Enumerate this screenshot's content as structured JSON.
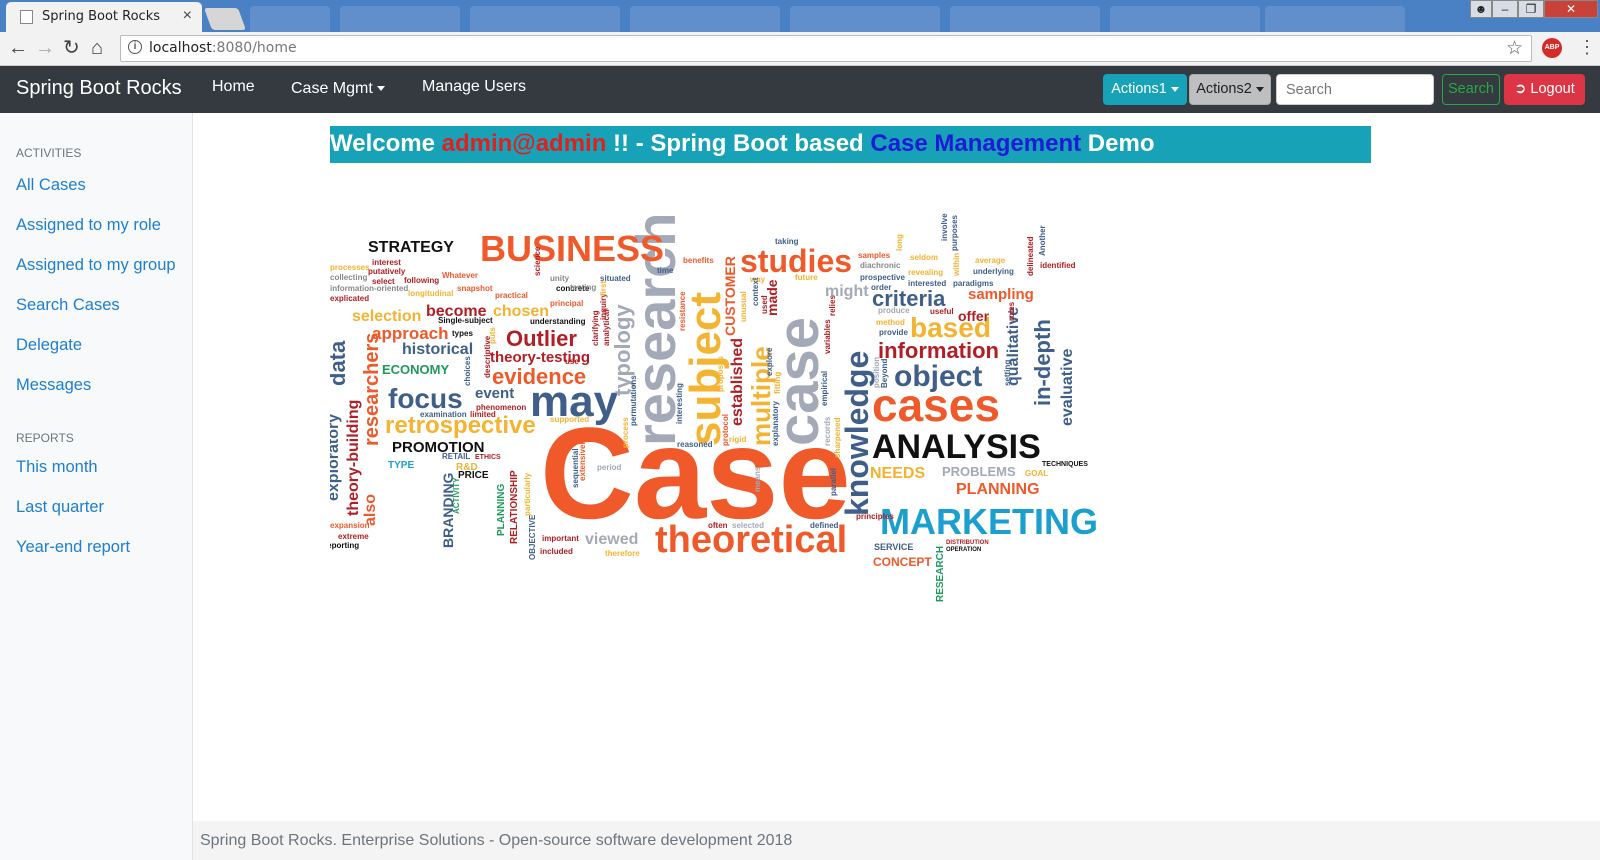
{
  "browser": {
    "tab_title": "Spring Boot Rocks",
    "tab_close": "×",
    "url_host": "localhost",
    "url_path": ":8080/home",
    "adblock_label": "ABP"
  },
  "navbar": {
    "brand": "Spring Boot Rocks",
    "links": {
      "home": "Home",
      "case_mgmt": "Case Mgmt",
      "manage_users": "Manage Users"
    },
    "actions1": "Actions1",
    "actions2": "Actions2",
    "search_placeholder": "Search",
    "search_button": "Search",
    "logout": "Logout"
  },
  "sidebar": {
    "activities_heading": "ACTIVITIES",
    "activities": [
      "All Cases",
      "Assigned to my role",
      "Assigned to my group",
      "Search Cases",
      "Delegate",
      "Messages"
    ],
    "reports_heading": "REPORTS",
    "reports": [
      "This month",
      "Last quarter",
      "Year-end report"
    ]
  },
  "banner": {
    "prefix": "Welcome ",
    "user": "admin@admin",
    "middle": " !! - Spring Boot based ",
    "highlight": "Case Management",
    "suffix": " Demo"
  },
  "wordcloud": {
    "words": [
      "Case",
      "research",
      "case",
      "subject",
      "BUSINESS",
      "MARKETING",
      "theoretical",
      "cases",
      "ANALYSIS",
      "may",
      "knowledge",
      "studies",
      "object",
      "information",
      "retrospective",
      "focus",
      "evidence",
      "Outlier",
      "STRATEGY",
      "criteria",
      "based",
      "PROMOTION",
      "ECONOMY",
      "PLANNING",
      "NEEDS",
      "PROBLEMS",
      "typology",
      "multiple",
      "established",
      "data",
      "researchers",
      "exploratory",
      "theory-building",
      "also",
      "BRANDING",
      "selection",
      "approach",
      "historical",
      "become",
      "chosen",
      "theory-testing",
      "event",
      "viewed",
      "qualitative",
      "in-depth",
      "evaluative",
      "sampling",
      "offer",
      "might",
      "CUSTOMER",
      "CONCEPT",
      "SERVICE",
      "RESEARCH",
      "made",
      "PRICE",
      "RELATIONSHIP",
      "OBJECTIVE",
      "important",
      "included",
      "therefore",
      "often",
      "selected",
      "defined",
      "principles",
      "TECHNIQUES",
      "GOAL",
      "DISTRIBUTION",
      "OPERATION",
      "TYPE",
      "RETAIL",
      "R&D",
      "ETHICS",
      "PLANNING",
      "ACTIVITY",
      "interest",
      "putatively",
      "processes",
      "collecting",
      "information-oriented",
      "explicated",
      "select",
      "following",
      "Whatever",
      "snapshot",
      "longitudinal",
      "practical",
      "science",
      "concrete",
      "principal",
      "situated",
      "testing",
      "unity",
      "taking",
      "benefits",
      "time",
      "future",
      "samples",
      "diachronic",
      "prospective",
      "order",
      "interested",
      "revealing",
      "seldom",
      "average",
      "underlying",
      "paradigms",
      "identified",
      "Another",
      "delineated",
      "Single-subject",
      "types",
      "understanding",
      "examination",
      "phenomenon",
      "limited",
      "supported",
      "period",
      "sequential",
      "extensively",
      "means",
      "explore",
      "fitting",
      "records",
      "empirical",
      "parallel",
      "variables",
      "relies",
      "Beyond",
      "position",
      "method",
      "produce",
      "provide",
      "useful",
      "setting",
      "roles",
      "expansion",
      "extreme",
      "reporting",
      "particularly",
      "rigid",
      "reasoned",
      "interesting",
      "permutations",
      "process",
      "clarifying",
      "inquiry",
      "analytical",
      "use",
      "first",
      "descriptive",
      "choices",
      "puts",
      "resistance",
      "protocol",
      "proposes",
      "unusual",
      "used",
      "way",
      "context",
      "within",
      "purposes",
      "involve",
      "long",
      "sharpened",
      "explanatory"
    ]
  },
  "footer": {
    "text": "Spring Boot Rocks. Enterprise Solutions - Open-source software development 2018"
  }
}
